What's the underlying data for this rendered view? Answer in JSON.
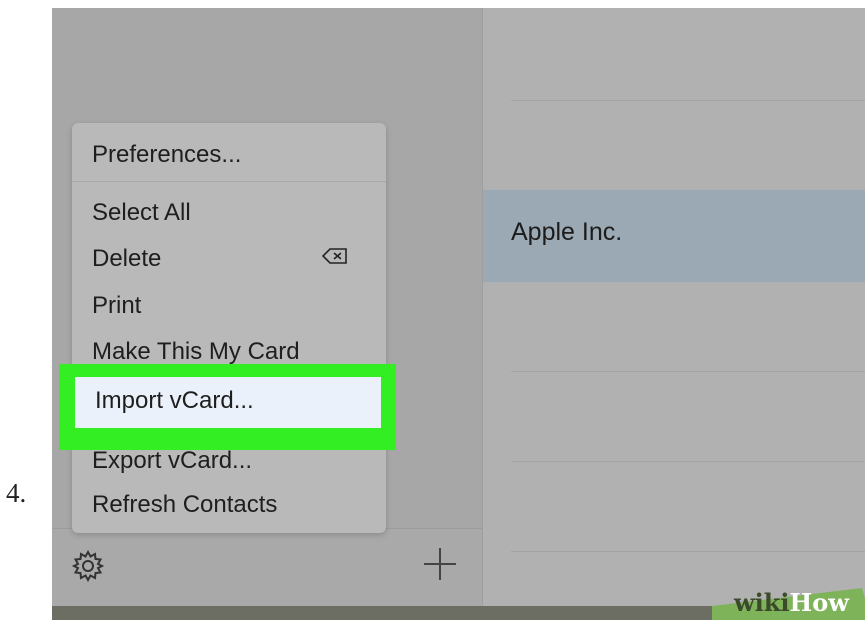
{
  "step": {
    "number": "4."
  },
  "menu": {
    "items": [
      {
        "label": "Preferences..."
      },
      {
        "label": "Select All"
      },
      {
        "label": "Delete"
      },
      {
        "label": "Print"
      },
      {
        "label": "Make This My Card"
      },
      {
        "label": "Import vCard..."
      },
      {
        "label": "Export vCard..."
      },
      {
        "label": "Refresh Contacts"
      }
    ],
    "highlighted": "Import vCard..."
  },
  "contacts": {
    "selected_name": "Apple Inc."
  },
  "icons": {
    "settings": "gear-icon",
    "add": "plus-icon",
    "delete_shortcut": "delete-key-icon"
  },
  "watermark": {
    "part1": "wiki",
    "part2": "How"
  },
  "colors": {
    "highlight_border": "#33ee22",
    "selected_row": "#9aa9b3",
    "sidebar": "#a7a7a7",
    "list_pane": "#b1b1b1"
  }
}
